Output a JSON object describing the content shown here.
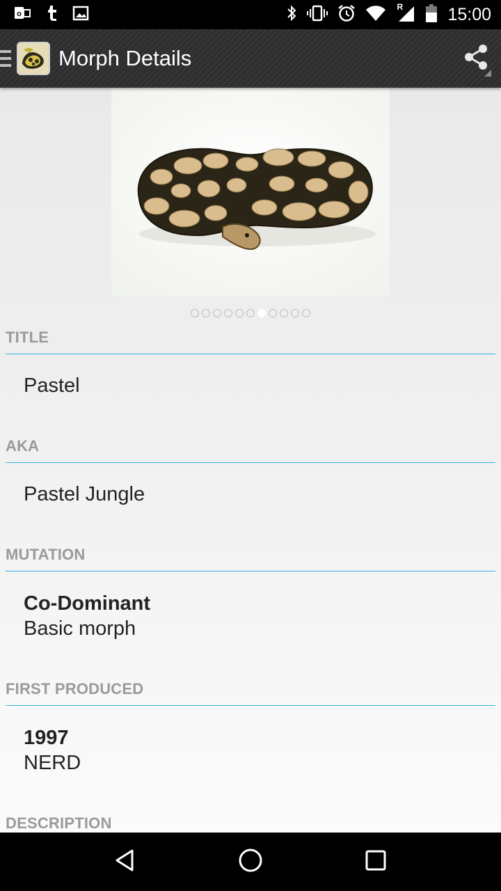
{
  "status_bar": {
    "time": "15:00",
    "left_icons": [
      "outlook-icon",
      "tumblr-icon",
      "gallery-icon"
    ],
    "right_icons": [
      "bluetooth-icon",
      "vibrate-icon",
      "alarm-icon",
      "wifi-icon",
      "cell-signal-icon",
      "battery-icon"
    ],
    "roaming_label": "R"
  },
  "action_bar": {
    "title": "Morph Details",
    "share_icon": "share-icon"
  },
  "gallery": {
    "page_count": 11,
    "active_index": 6
  },
  "sections": {
    "title": {
      "header": "TITLE",
      "value": "Pastel"
    },
    "aka": {
      "header": "AKA",
      "value": "Pastel Jungle"
    },
    "mutation": {
      "header": "MUTATION",
      "primary": "Co-Dominant",
      "secondary": "Basic morph"
    },
    "first_produced": {
      "header": "FIRST PRODUCED",
      "primary": "1997",
      "secondary": "NERD"
    },
    "description": {
      "header": "DESCRIPTION"
    }
  },
  "nav_bar": {
    "icons": [
      "back-icon",
      "home-icon",
      "recents-icon"
    ]
  },
  "colors": {
    "accent": "#33b5e5",
    "section_header": "#9a9a9a",
    "action_bar": "#2e2e2e"
  }
}
